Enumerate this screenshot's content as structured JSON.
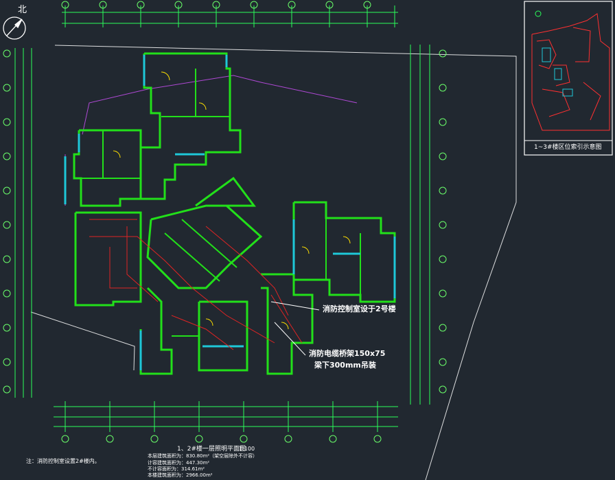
{
  "drawing": {
    "north": "北",
    "notes": {
      "fire_control": "消防控制室设于2号楼",
      "cable_tray_line1": "消防电缆桥架150x75",
      "cable_tray_line2": "梁下300mm吊装"
    },
    "title": "1、2#楼一层照明平面图",
    "scale": "1:100",
    "areas": [
      "本层建筑面积为：830.80m²（架空层除外不计容）",
      "计容建筑面积为：447.30m²",
      "不计容面积为：314.61m²",
      "本楼建筑面积为：2966.00m²"
    ],
    "remark": "注：消防控制室设置2#楼内。",
    "inset_caption": "1~3#楼区位索引示意图"
  },
  "colors": {
    "background": "#212830",
    "wall": "#22e01a",
    "window": "#1ec8d8",
    "dimension": "#2aff5a",
    "grid_line": "#ffffff",
    "axis_bubble": "#6aff6a",
    "wiring": "#e02424",
    "site_boundary": "#b049d6",
    "door_detail": "#ffe000",
    "inset_lines": "#ff3030"
  }
}
